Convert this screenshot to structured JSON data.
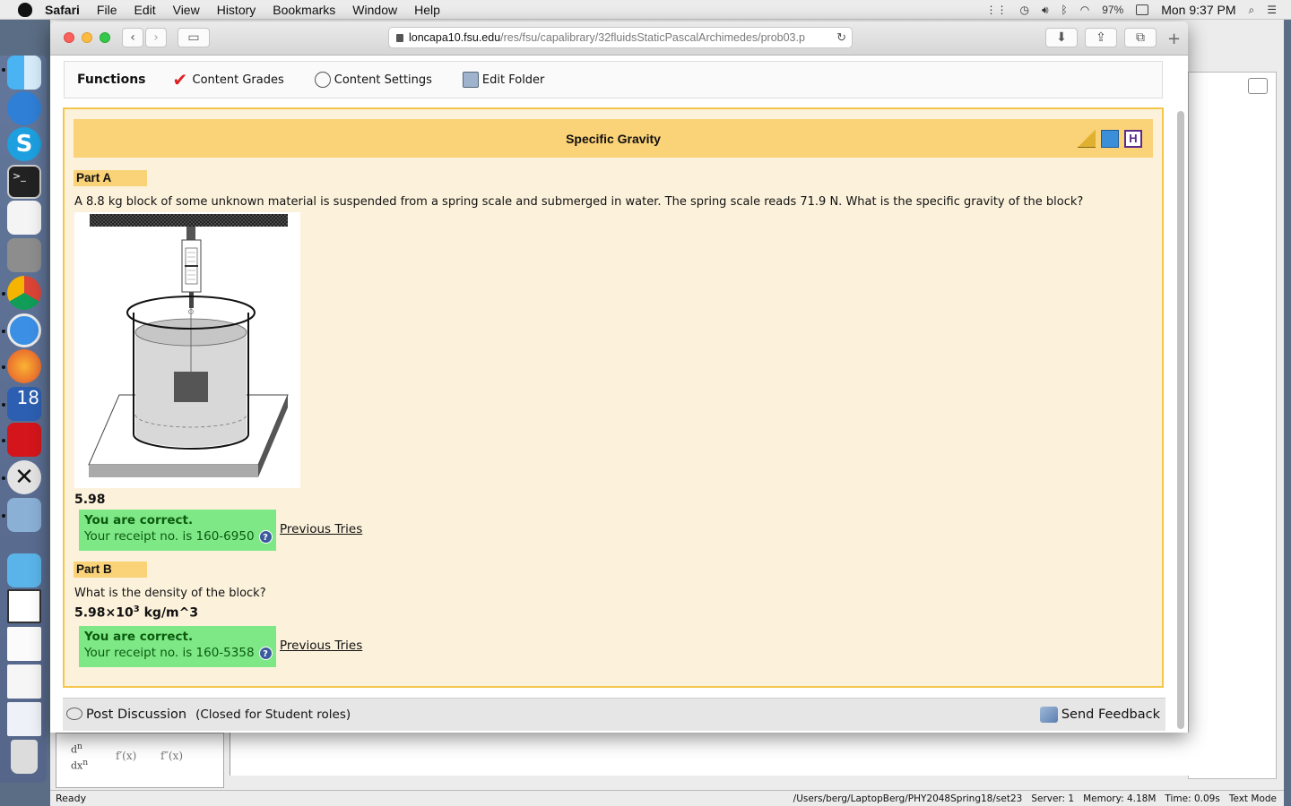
{
  "menubar": {
    "app": "Safari",
    "items": [
      "File",
      "Edit",
      "View",
      "History",
      "Bookmarks",
      "Window",
      "Help"
    ],
    "battery": "97%",
    "clock": "Mon 9:37 PM"
  },
  "browser": {
    "url_host": "loncapa10.fsu.edu",
    "url_path": "/res/fsu/capalibrary/32fluidsStaticPascalArchimedes/prob03.p"
  },
  "functions": {
    "label": "Functions",
    "items": [
      "Content Grades",
      "Content Settings",
      "Edit Folder"
    ]
  },
  "problem": {
    "title": "Specific Gravity",
    "partA": {
      "label": "Part A",
      "question": "A 8.8 kg block of some unknown material is suspended from a spring scale and submerged in water. The spring scale reads 71.9 N. What is the specific gravity of the block?",
      "answer": "5.98",
      "status": "You are correct.",
      "receipt": "Your receipt no. is 160-6950",
      "prev": "Previous Tries"
    },
    "partB": {
      "label": "Part B",
      "question": "What is the density of the block?",
      "answer_base": "5.98×10",
      "answer_exp": "3",
      "answer_unit": " kg/m^3",
      "status": "You are correct.",
      "receipt": "Your receipt no. is 160-5358",
      "prev": "Previous Tries"
    }
  },
  "discussion": {
    "post": "Post Discussion",
    "closed": "(Closed for Student roles)",
    "feedback": "Send Feedback"
  },
  "statusbar": {
    "left": "Ready",
    "path": "/Users/berg/LaptopBerg/PHY2048Spring18/set23",
    "server": "Server: 1",
    "memory": "Memory: 4.18M",
    "time": "Time: 0.09s",
    "mode": "Text Mode"
  },
  "dock_badge": "18",
  "math_palette": [
    "f′(x)",
    "f″(x)"
  ]
}
